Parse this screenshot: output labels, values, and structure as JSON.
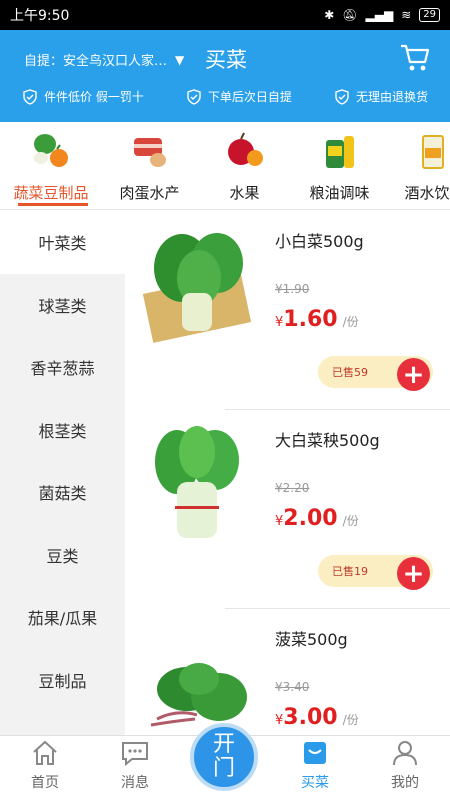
{
  "status_bar": {
    "time": "上午9:50",
    "battery": "29"
  },
  "header": {
    "location": "自提：安全鸟汉口人家服...",
    "title": "买菜",
    "guarantees": [
      "件件低价 假一罚十",
      "下单后次日自提",
      "无理由退换货"
    ]
  },
  "categories": [
    {
      "label": "蔬菜豆制品",
      "active": true
    },
    {
      "label": "肉蛋水产",
      "active": false
    },
    {
      "label": "水果",
      "active": false
    },
    {
      "label": "粮油调味",
      "active": false
    },
    {
      "label": "酒水饮料",
      "active": false
    }
  ],
  "sidemenu": [
    {
      "label": "叶菜类",
      "active": true
    },
    {
      "label": "球茎类",
      "active": false
    },
    {
      "label": "香辛葱蒜",
      "active": false
    },
    {
      "label": "根茎类",
      "active": false
    },
    {
      "label": "菌菇类",
      "active": false
    },
    {
      "label": "豆类",
      "active": false
    },
    {
      "label": "茄果/瓜果",
      "active": false
    },
    {
      "label": "豆制品",
      "active": false
    }
  ],
  "products": [
    {
      "name": "小白菜500g",
      "original_price": "¥1.90",
      "currency": "¥",
      "price": "1.60",
      "unit": "/份",
      "sold": "已售59"
    },
    {
      "name": "大白菜秧500g",
      "original_price": "¥2.20",
      "currency": "¥",
      "price": "2.00",
      "unit": "/份",
      "sold": "已售19"
    },
    {
      "name": "菠菜500g",
      "original_price": "¥3.40",
      "currency": "¥",
      "price": "3.00",
      "unit": "/份",
      "sold": ""
    }
  ],
  "bottom_nav": {
    "home": "首页",
    "messages": "消息",
    "open_door": [
      "开",
      "门"
    ],
    "buy": "买菜",
    "mine": "我的"
  },
  "colors": {
    "primary": "#2aa0ea",
    "accent": "#e6552a",
    "price": "#e02020",
    "add": "#e8303c"
  }
}
